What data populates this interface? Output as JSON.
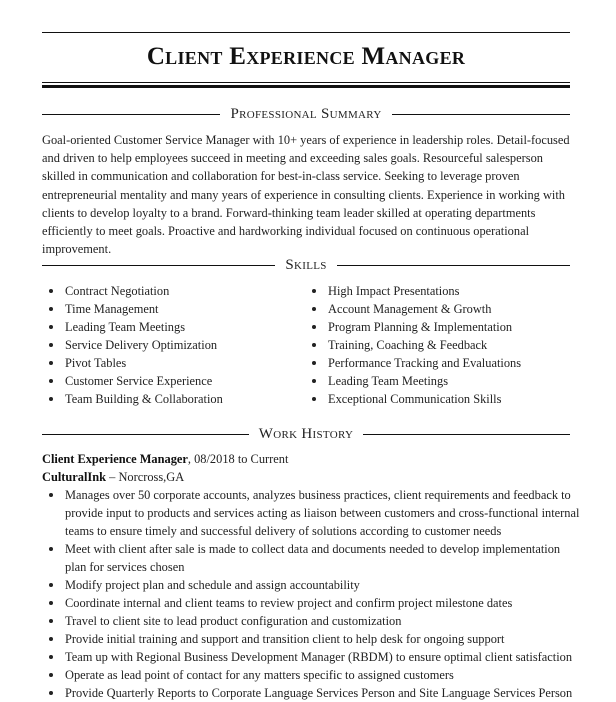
{
  "header": {
    "title": "Client Experience Manager"
  },
  "sections": {
    "summary": {
      "heading": "Professional Summary",
      "text": "Goal-oriented Customer Service Manager with 10+ years of experience in leadership roles. Detail-focused and driven to help employees succeed in meeting and exceeding sales goals. Resourceful salesperson skilled in communication and collaboration for best-in-class service. Seeking to leverage proven entrepreneurial mentality and many years of experience in consulting clients. Experience in working with clients to develop loyalty to a brand. Forward-thinking team leader skilled at operating departments efficiently to meet goals. Proactive and hardworking individual focused on continuous operational improvement."
    },
    "skills": {
      "heading": "Skills",
      "left": [
        "Contract Negotiation",
        "Time Management",
        "Leading Team Meetings",
        "Service Delivery Optimization",
        "Pivot Tables",
        "Customer Service Experience",
        "Team Building & Collaboration"
      ],
      "right": [
        "High Impact Presentations",
        "Account Management & Growth",
        "Program Planning & Implementation",
        "Training, Coaching & Feedback",
        "Performance Tracking and Evaluations",
        "Leading Team Meetings",
        "Exceptional Communication Skills"
      ]
    },
    "work_history": {
      "heading": "Work History",
      "jobs": [
        {
          "title": "Client Experience Manager",
          "dates": ", 08/2018 to Current",
          "company": "CulturalInk",
          "location": " – Norcross,GA",
          "duties": [
            "Manages over 50 corporate accounts, analyzes business practices, client requirements and feedback to provide input to products and services acting as liaison between customers and cross-functional internal teams to ensure timely and successful delivery of solutions according to customer needs",
            "Meet with client after sale is made to collect data and documents needed to develop implementation plan for services chosen",
            "Modify project plan and schedule and assign accountability",
            "Coordinate internal and client teams to review project and confirm project milestone dates",
            "Travel to client site to lead product configuration and customization",
            "Provide initial training and support and transition client to help desk for ongoing support",
            "Team up with Regional Business Development Manager (RBDM) to ensure optimal client satisfaction",
            "Operate as lead point of contact for any matters specific to assigned customers",
            "Provide Quarterly Reports to Corporate Language Services Person and Site Language Services Person"
          ]
        }
      ]
    }
  }
}
